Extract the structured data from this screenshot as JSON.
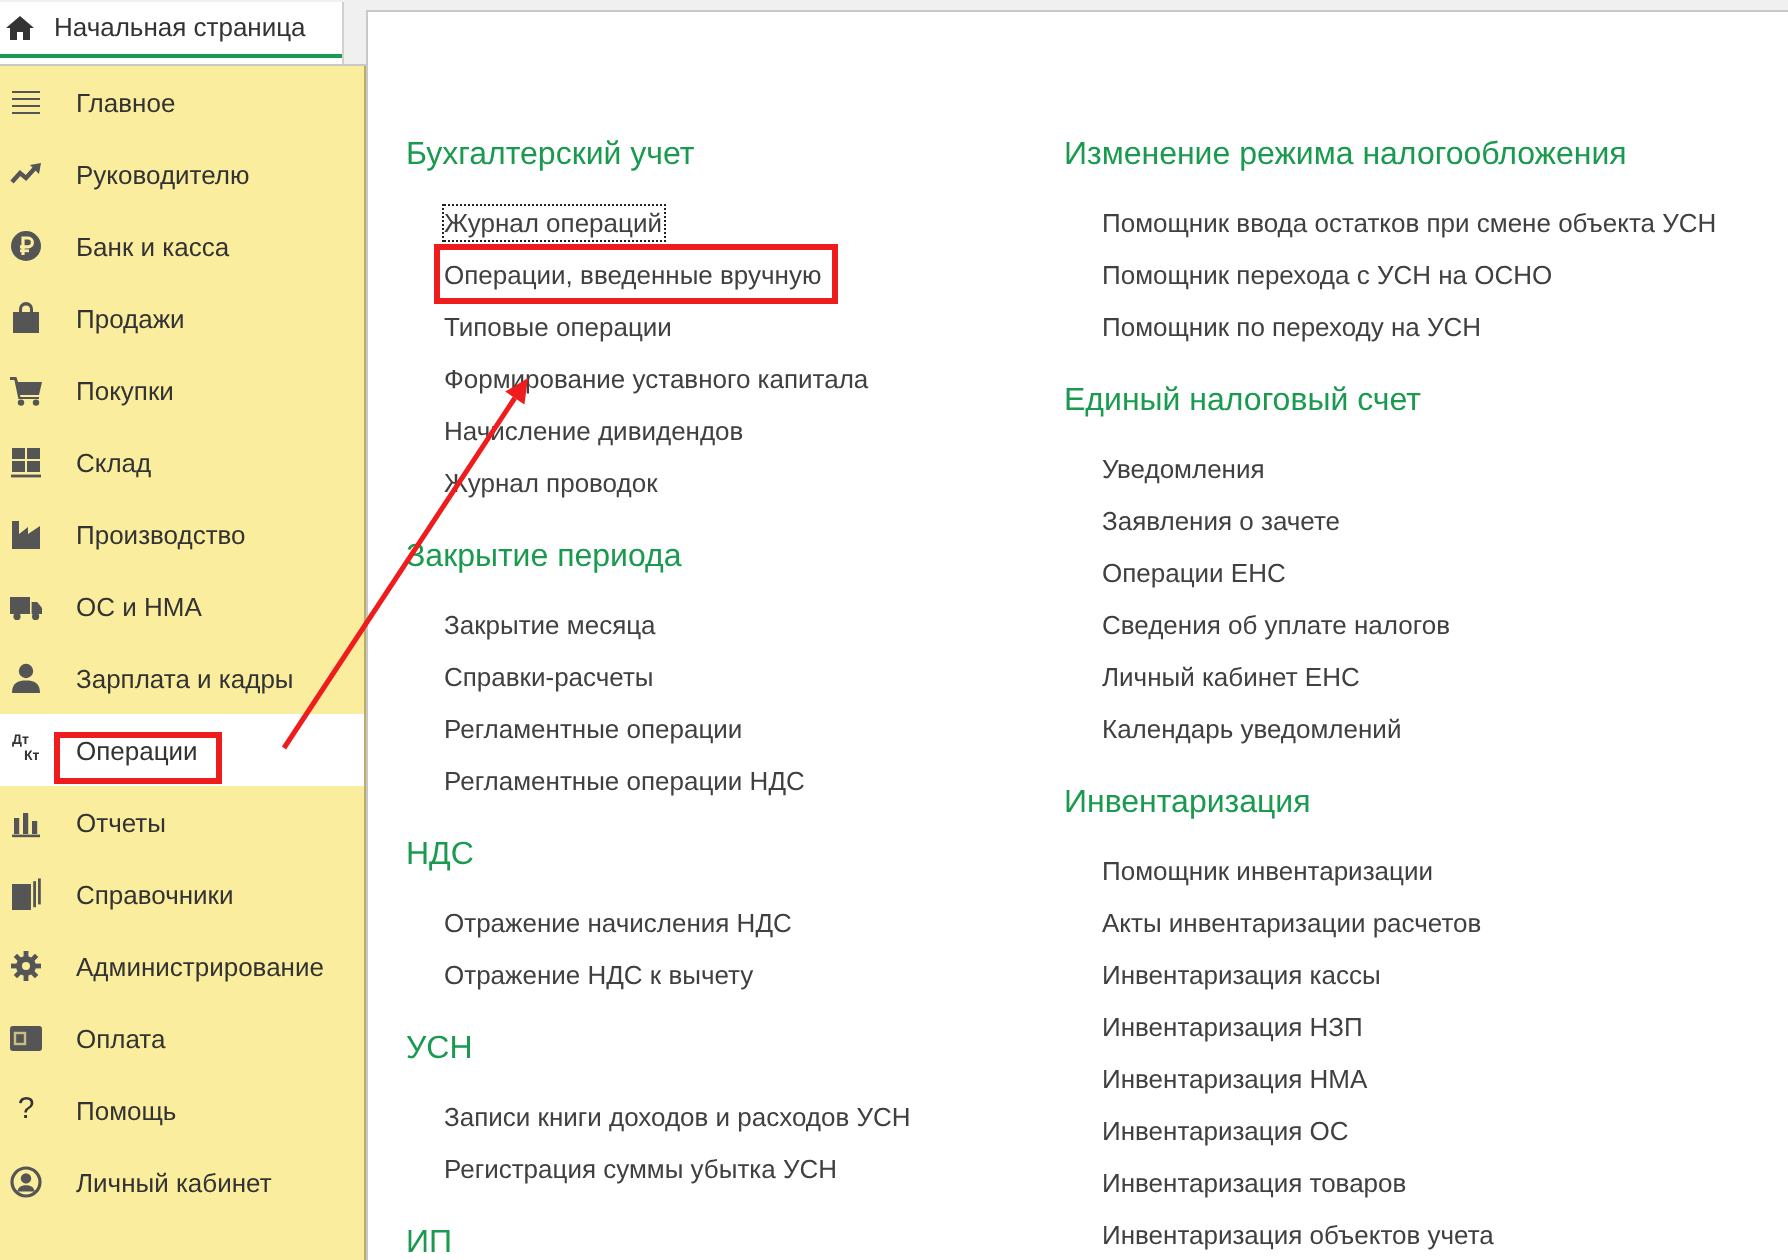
{
  "tab": {
    "label": "Начальная страница",
    "selected": true
  },
  "sidebar": {
    "items": [
      {
        "label": "Главное",
        "selected": false,
        "highlighted": false
      },
      {
        "label": "Руководителю",
        "selected": false,
        "highlighted": false
      },
      {
        "label": "Банк и касса",
        "selected": false,
        "highlighted": false
      },
      {
        "label": "Продажи",
        "selected": false,
        "highlighted": false
      },
      {
        "label": "Покупки",
        "selected": false,
        "highlighted": false
      },
      {
        "label": "Склад",
        "selected": false,
        "highlighted": false
      },
      {
        "label": "Производство",
        "selected": false,
        "highlighted": false
      },
      {
        "label": "ОС и НМА",
        "selected": false,
        "highlighted": false
      },
      {
        "label": "Зарплата и кадры",
        "selected": false,
        "highlighted": false
      },
      {
        "label": "Операции",
        "icon_text": [
          "Дт",
          "Кт"
        ],
        "selected": true,
        "highlighted": true
      },
      {
        "label": "Отчеты",
        "selected": false,
        "highlighted": false
      },
      {
        "label": "Справочники",
        "selected": false,
        "highlighted": false
      },
      {
        "label": "Администрирование",
        "selected": false,
        "highlighted": false
      },
      {
        "label": "Оплата",
        "selected": false,
        "highlighted": false
      },
      {
        "label": "Помощь",
        "icon_text": [
          "?"
        ],
        "selected": false,
        "highlighted": false
      },
      {
        "label": "Личный кабинет",
        "selected": false,
        "highlighted": false
      }
    ]
  },
  "content": {
    "columns": [
      {
        "sections": [
          {
            "title": "Бухгалтерский учет",
            "links": [
              {
                "label": "Журнал операций",
                "focused": true,
                "highlighted": false
              },
              {
                "label": "Операции, введенные вручную",
                "focused": false,
                "highlighted": true
              },
              {
                "label": "Типовые операции",
                "focused": false,
                "highlighted": false
              },
              {
                "label": "Формирование уставного капитала",
                "focused": false,
                "highlighted": false
              },
              {
                "label": "Начисление дивидендов",
                "focused": false,
                "highlighted": false
              },
              {
                "label": "Журнал проводок",
                "focused": false,
                "highlighted": false
              }
            ]
          },
          {
            "title": "Закрытие периода",
            "links": [
              {
                "label": "Закрытие месяца",
                "focused": false,
                "highlighted": false
              },
              {
                "label": "Справки-расчеты",
                "focused": false,
                "highlighted": false
              },
              {
                "label": "Регламентные операции",
                "focused": false,
                "highlighted": false
              },
              {
                "label": "Регламентные операции НДС",
                "focused": false,
                "highlighted": false
              }
            ]
          },
          {
            "title": "НДС",
            "links": [
              {
                "label": "Отражение начисления НДС",
                "focused": false,
                "highlighted": false
              },
              {
                "label": "Отражение НДС к вычету",
                "focused": false,
                "highlighted": false
              }
            ]
          },
          {
            "title": "УСН",
            "links": [
              {
                "label": "Записи книги доходов и расходов УСН",
                "focused": false,
                "highlighted": false
              },
              {
                "label": "Регистрация суммы убытка УСН",
                "focused": false,
                "highlighted": false
              }
            ]
          },
          {
            "title": "ИП"
          }
        ]
      },
      {
        "sections": [
          {
            "title": "Изменение режима налогообложения",
            "links": [
              {
                "label": "Помощник ввода остатков при смене объекта УСН",
                "focused": false,
                "highlighted": false
              },
              {
                "label": "Помощник перехода с УСН на ОСНО",
                "focused": false,
                "highlighted": false
              },
              {
                "label": "Помощник по переходу на УСН",
                "focused": false,
                "highlighted": false
              }
            ]
          },
          {
            "title": "Единый налоговый счет",
            "links": [
              {
                "label": "Уведомления",
                "focused": false,
                "highlighted": false
              },
              {
                "label": "Заявления о зачете",
                "focused": false,
                "highlighted": false
              },
              {
                "label": "Операции ЕНС",
                "focused": false,
                "highlighted": false
              },
              {
                "label": "Сведения об уплате налогов",
                "focused": false,
                "highlighted": false
              },
              {
                "label": "Личный кабинет ЕНС",
                "focused": false,
                "highlighted": false
              },
              {
                "label": "Календарь уведомлений",
                "focused": false,
                "highlighted": false
              }
            ]
          },
          {
            "title": "Инвентаризация",
            "links": [
              {
                "label": "Помощник инвентаризации",
                "focused": false,
                "highlighted": false
              },
              {
                "label": "Акты инвентаризации расчетов",
                "focused": false,
                "highlighted": false
              },
              {
                "label": "Инвентаризация кассы",
                "focused": false,
                "highlighted": false
              },
              {
                "label": "Инвентаризация НЗП",
                "focused": false,
                "highlighted": false
              },
              {
                "label": "Инвентаризация НМА",
                "focused": false,
                "highlighted": false
              },
              {
                "label": "Инвентаризация ОС",
                "focused": false,
                "highlighted": false
              },
              {
                "label": "Инвентаризация товаров",
                "focused": false,
                "highlighted": false
              },
              {
                "label": "Инвентаризация объектов учета",
                "focused": false,
                "highlighted": false
              }
            ]
          }
        ]
      }
    ]
  }
}
